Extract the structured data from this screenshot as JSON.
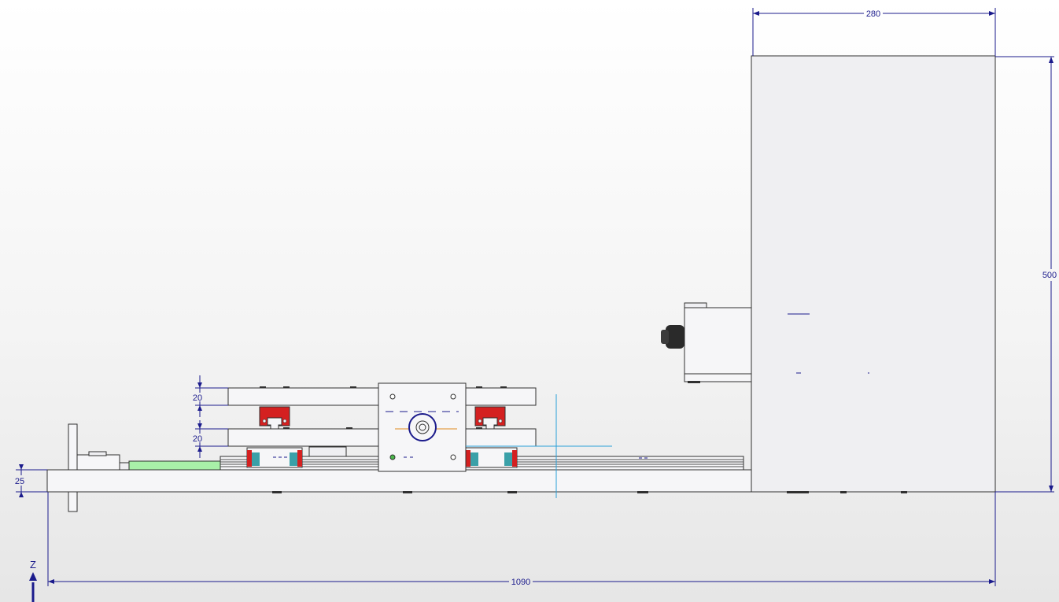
{
  "drawing": {
    "title": "",
    "view": "side elevation",
    "colors": {
      "dimension": "#1b1b8c",
      "part_fill": "#efeff2",
      "outline": "#303030",
      "rail_block_red": "#d42020",
      "rail_block_teal": "#3aa0a8",
      "shaft_green": "#a8f0a8",
      "center_line": "#2aa0d8",
      "motor_knob": "#2a2a2a"
    }
  },
  "dimensions": {
    "overall_length": "1090",
    "cabinet_width": "280",
    "cabinet_height": "500",
    "base_thickness": "25",
    "upper_plate_thickness": "20",
    "lower_plate_thickness": "20"
  },
  "axis": {
    "label": "Z"
  }
}
